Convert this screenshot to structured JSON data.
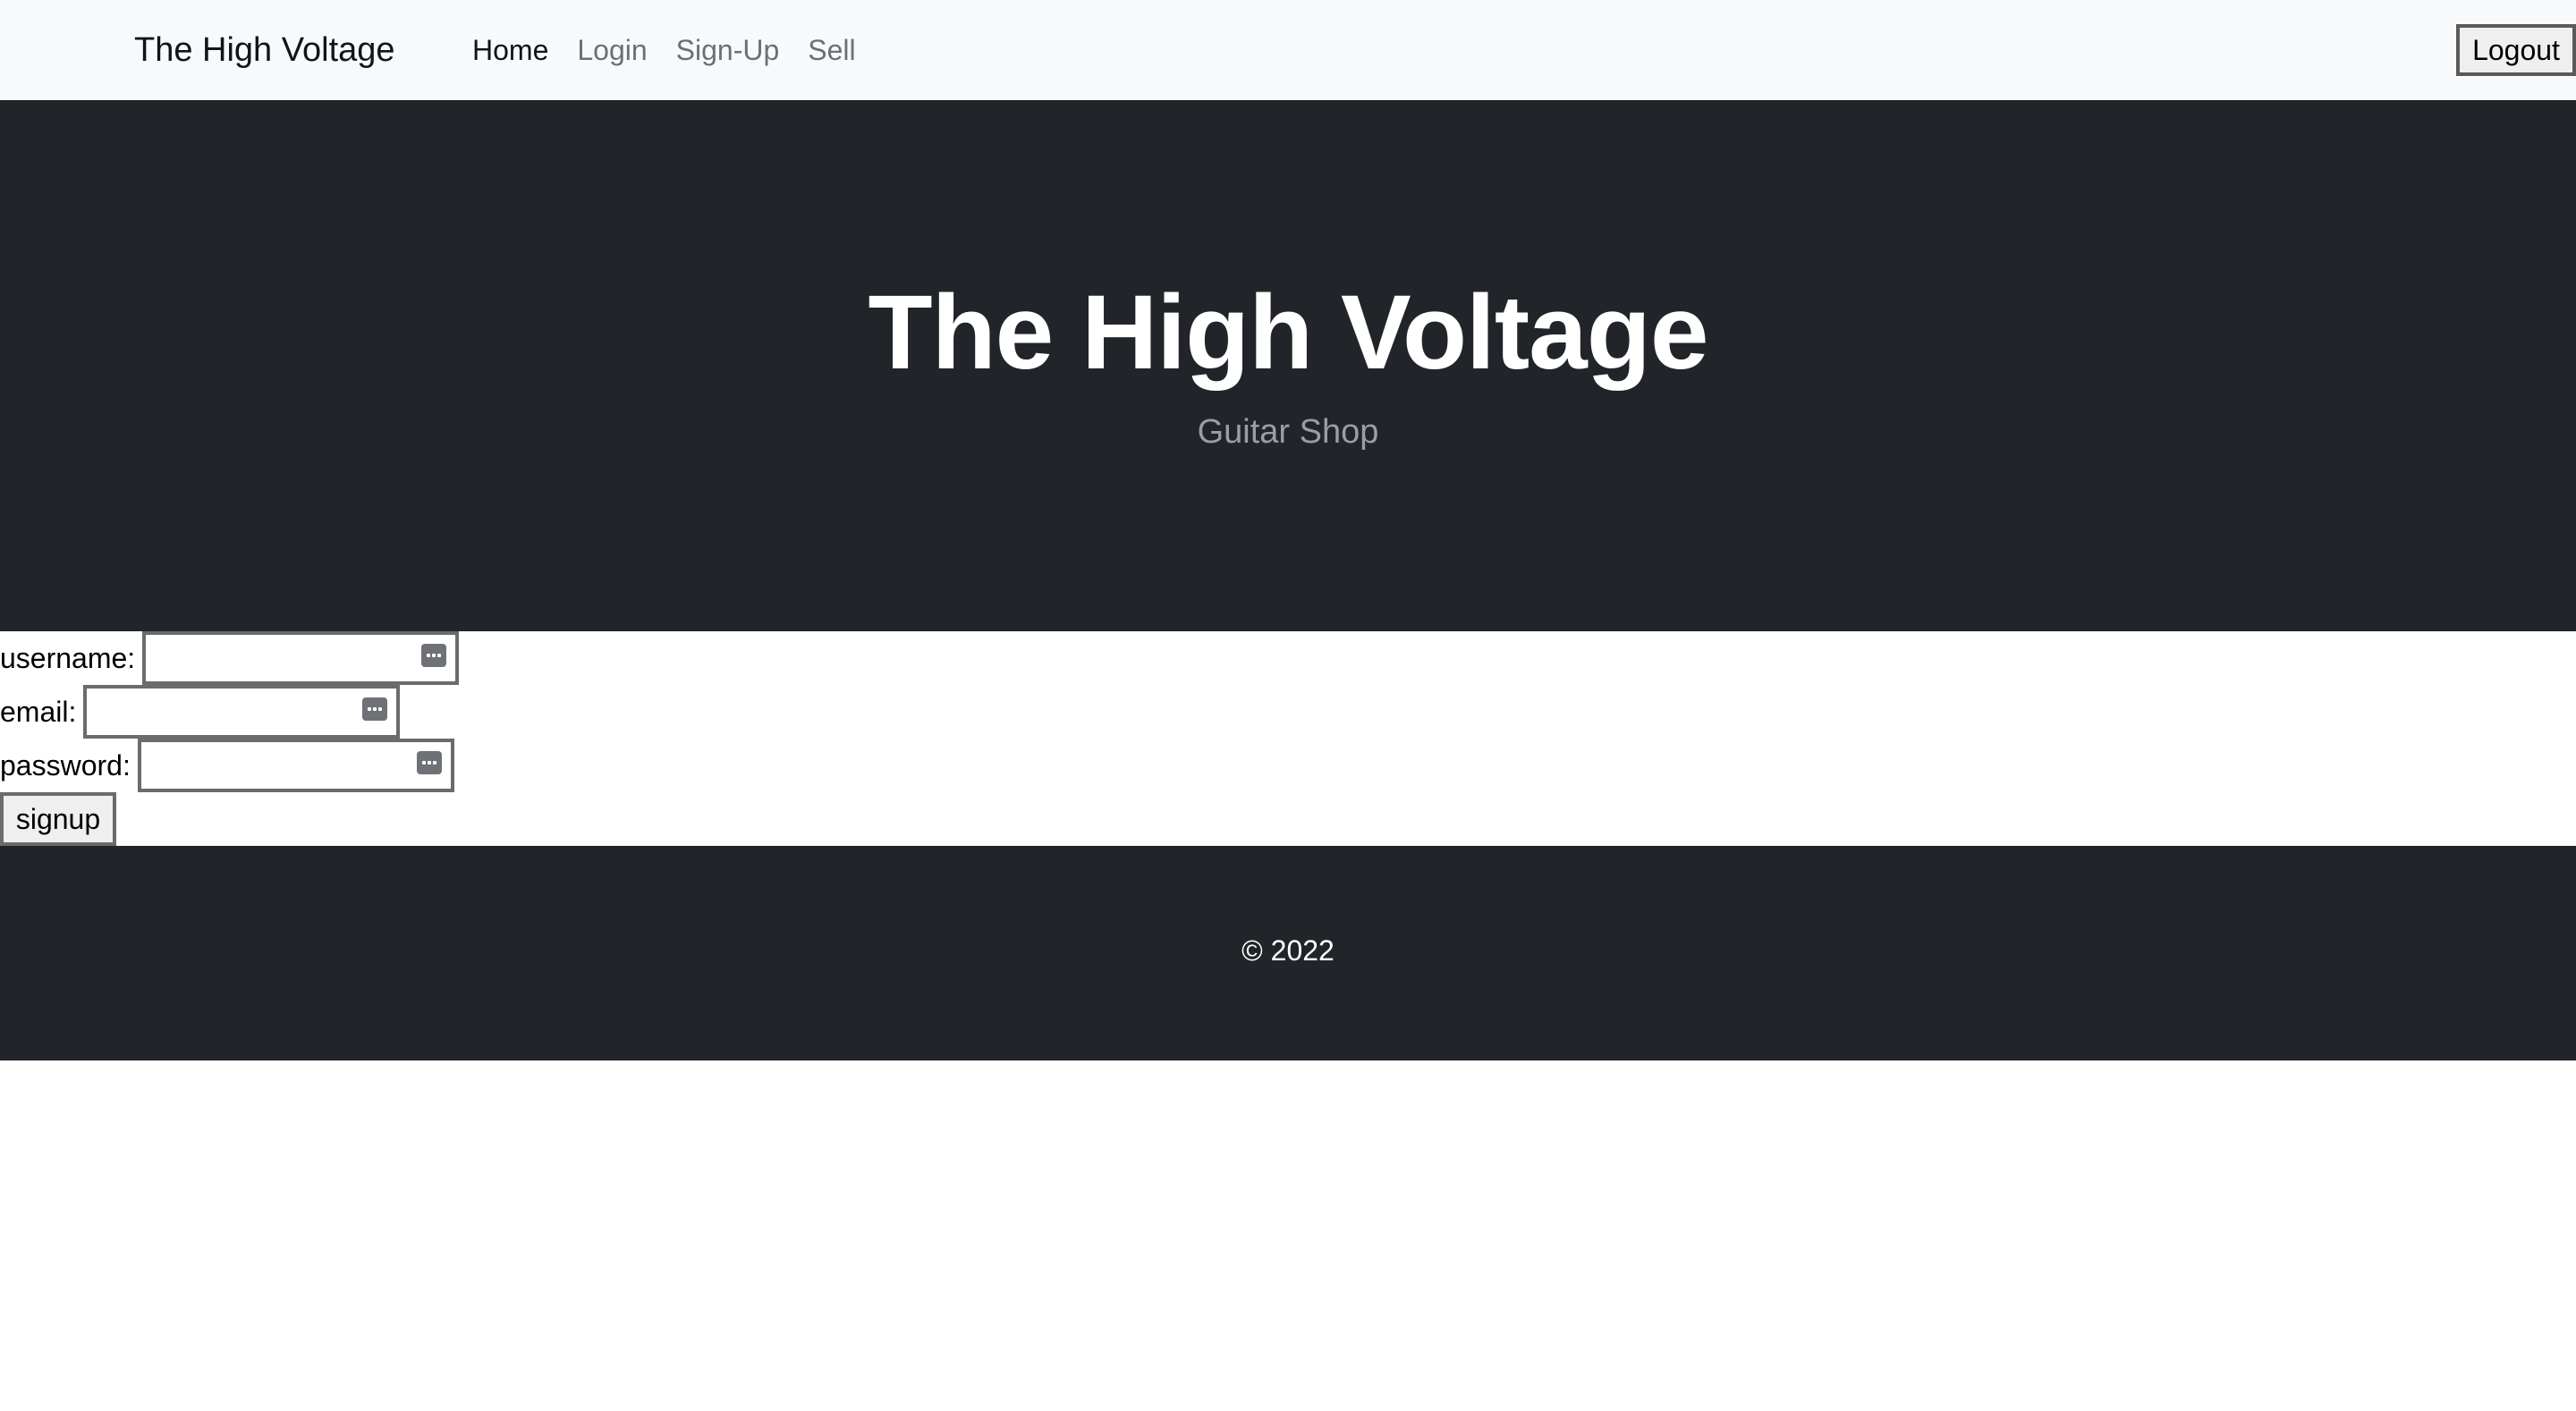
{
  "navbar": {
    "brand": "The High Voltage",
    "links": [
      {
        "label": "Home",
        "active": true
      },
      {
        "label": "Login",
        "active": false
      },
      {
        "label": "Sign-Up",
        "active": false
      },
      {
        "label": "Sell",
        "active": false
      }
    ],
    "logout_label": "Logout"
  },
  "hero": {
    "title": "The High Voltage",
    "subtitle": "Guitar Shop"
  },
  "signup_form": {
    "username_label": "username:",
    "username_value": "",
    "email_label": "email:",
    "email_value": "",
    "password_label": "password:",
    "password_value": "",
    "submit_label": "signup",
    "autofill_icon": "password-key-icon"
  },
  "footer": {
    "copyright": "© 2022"
  },
  "colors": {
    "navbar_bg": "#f8f9fa",
    "dark_bg": "#212529",
    "hero_title": "#ffffff",
    "hero_subtitle": "#9a9ea2",
    "nav_link_inactive": "#6b7075"
  }
}
